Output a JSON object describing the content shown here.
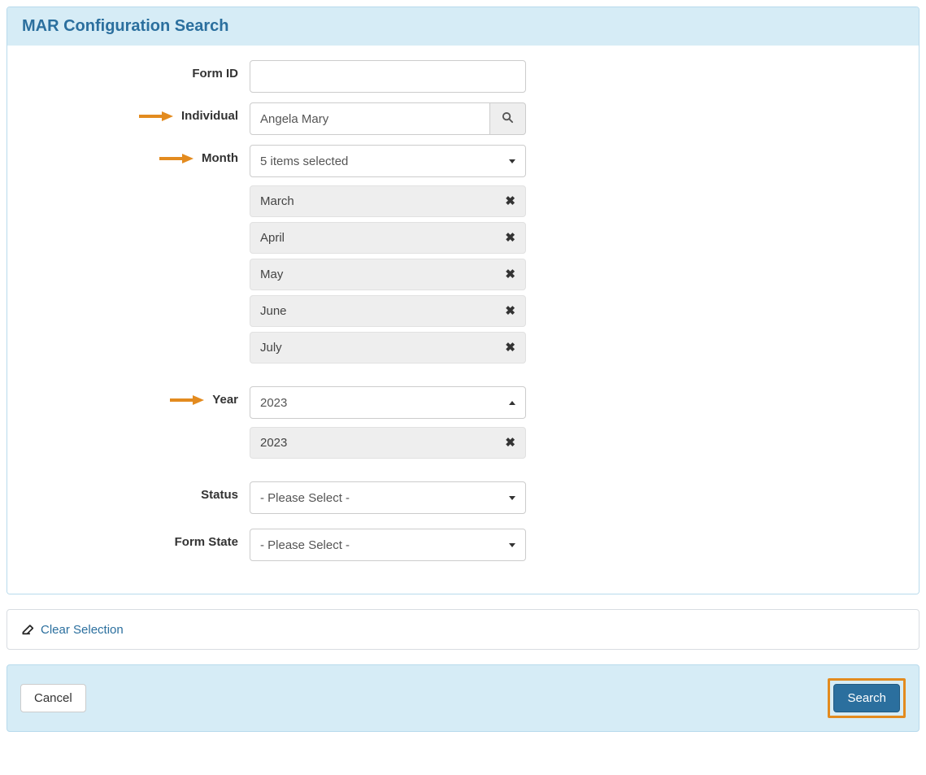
{
  "panel": {
    "title": "MAR Configuration Search"
  },
  "fields": {
    "formId": {
      "label": "Form ID",
      "value": ""
    },
    "individual": {
      "label": "Individual",
      "value": "Angela Mary"
    },
    "month": {
      "label": "Month",
      "summary": "5 items selected",
      "selected": [
        "March",
        "April",
        "May",
        "June",
        "July"
      ]
    },
    "year": {
      "label": "Year",
      "summary": "2023",
      "selected": [
        "2023"
      ]
    },
    "status": {
      "label": "Status",
      "placeholder": "- Please Select -"
    },
    "formState": {
      "label": "Form State",
      "placeholder": "- Please Select -"
    }
  },
  "actions": {
    "clear": "Clear Selection",
    "cancel": "Cancel",
    "search": "Search"
  }
}
